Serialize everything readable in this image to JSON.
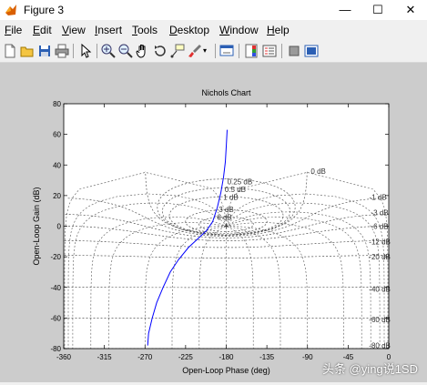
{
  "window": {
    "title": "Figure 3"
  },
  "window_controls": {
    "minimize": "—",
    "maximize": "☐",
    "close": "✕"
  },
  "menu": [
    {
      "label": "File",
      "key": "F",
      "rest": "ile"
    },
    {
      "label": "Edit",
      "key": "E",
      "rest": "dit"
    },
    {
      "label": "View",
      "key": "V",
      "rest": "iew"
    },
    {
      "label": "Insert",
      "key": "I",
      "rest": "nsert"
    },
    {
      "label": "Tools",
      "key": "T",
      "rest": "ools"
    },
    {
      "label": "Desktop",
      "key": "D",
      "rest": "esktop"
    },
    {
      "label": "Window",
      "key": "W",
      "rest": "indow"
    },
    {
      "label": "Help",
      "key": "H",
      "rest": "elp"
    }
  ],
  "toolbar_icons": [
    "new-figure-icon",
    "open-file-icon",
    "save-icon",
    "print-icon",
    "edit-plot-arrow-icon",
    "zoom-in-icon",
    "zoom-out-icon",
    "pan-hand-icon",
    "rotate-3d-icon",
    "data-cursor-icon",
    "brush-icon",
    "link-plot-icon",
    "colorbar-icon",
    "legend-icon",
    "hide-plot-tools-icon",
    "show-plot-tools-icon"
  ],
  "watermark": "头条 @ying说1SD",
  "chart_data": {
    "type": "line",
    "title": "Nichols Chart",
    "xlabel": "Open-Loop Phase (deg)",
    "ylabel": "Open-Loop Gain (dB)",
    "xlim": [
      -360,
      0
    ],
    "ylim": [
      -80,
      80
    ],
    "xticks": [
      -360,
      -315,
      -270,
      -225,
      -180,
      -135,
      -90,
      -45,
      0
    ],
    "yticks": [
      -80,
      -60,
      -40,
      -20,
      0,
      20,
      40,
      60,
      80
    ],
    "grid_labels": [
      "0 dB",
      "0.25 dB",
      "0.5 dB",
      "1 dB",
      "3 dB",
      "6 dB",
      "-1 dB",
      "-3 dB",
      "-6 dB",
      "-12 dB",
      "-20 dB",
      "-40 dB",
      "-60 dB",
      "-80 dB"
    ],
    "series": [
      {
        "color": "#0000ff",
        "x": [
          -267,
          -266,
          -262,
          -257,
          -250,
          -242,
          -233,
          -222,
          -211,
          -202,
          -195,
          -190,
          -186,
          -183,
          -181,
          -180,
          -179
        ],
        "y": [
          -78,
          -70,
          -60,
          -50,
          -40,
          -30,
          -22,
          -14,
          -8,
          -3,
          3,
          12,
          22,
          32,
          42,
          52,
          63
        ]
      }
    ],
    "grid": true,
    "colors": {
      "axes_background": "#ffffff",
      "figure_background": "#cccccc",
      "grid": "#555555"
    }
  }
}
